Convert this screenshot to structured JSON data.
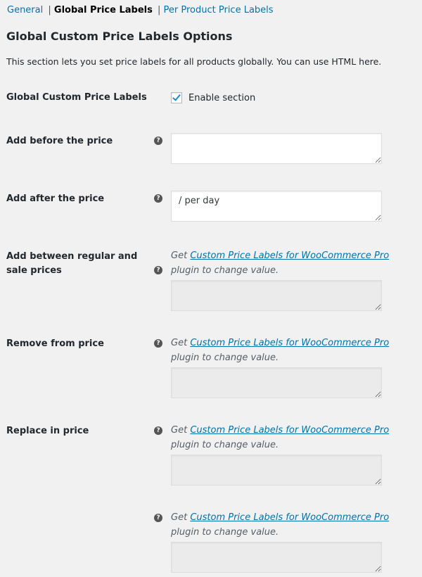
{
  "subnav": {
    "general": "General",
    "global": "Global Price Labels",
    "per_product": "Per Product Price Labels",
    "separator": "|"
  },
  "title": "Global Custom Price Labels Options",
  "description": "This section lets you set price labels for all products globally. You can use HTML here.",
  "enable": {
    "label": "Global Custom Price Labels",
    "checkbox_label": "Enable section",
    "checked": true
  },
  "fields": {
    "before": {
      "label": "Add before the price",
      "value": ""
    },
    "after": {
      "label": "Add after the price",
      "value": "/ per day"
    },
    "between": {
      "label": "Add between regular and sale prices"
    },
    "remove": {
      "label": "Remove from price"
    },
    "replace": {
      "label": "Replace in price"
    }
  },
  "pro_note": {
    "prefix": "Get ",
    "link": "Custom Price Labels for WooCommerce Pro",
    "suffix": " plugin to change value."
  },
  "help_icon": "?",
  "colors": {
    "link": "#0073aa",
    "background": "#f1f1f1",
    "check": "#1e8cbe"
  }
}
